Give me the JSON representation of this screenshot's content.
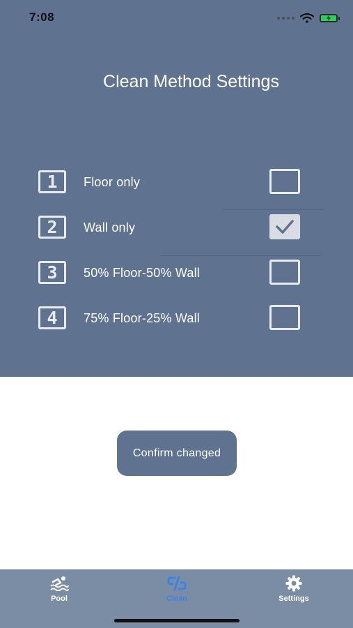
{
  "status_bar": {
    "time": "7:08"
  },
  "title": "Clean Method Settings",
  "options": [
    {
      "number": "1",
      "label": "Floor only",
      "checked": false
    },
    {
      "number": "2",
      "label": "Wall only",
      "checked": true
    },
    {
      "number": "3",
      "label": "50% Floor-50% Wall",
      "checked": false
    },
    {
      "number": "4",
      "label": "75% Floor-25% Wall",
      "checked": false
    }
  ],
  "confirm_label": "Confirm changed",
  "tabs": [
    {
      "label": "Pool",
      "icon": "swimmer-icon",
      "active": false
    },
    {
      "label": "Clean",
      "icon": "clean-icon",
      "active": true
    },
    {
      "label": "Settings",
      "icon": "gear-icon",
      "active": false
    }
  ],
  "colors": {
    "panel": "#5f7390",
    "tab_bar": "#7b8ca5",
    "active_tab": "#3b82e8",
    "battery": "#2ed158"
  }
}
